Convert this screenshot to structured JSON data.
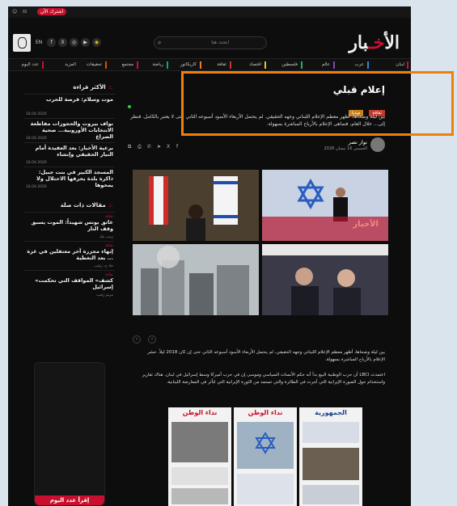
{
  "topbar": {
    "subscribe_label": "اشترك الأن"
  },
  "header": {
    "language": "EN",
    "search_placeholder": "ابحث هنا",
    "logo_main": "الأ",
    "logo_accent": "خـ",
    "logo_end": "بار"
  },
  "nav": {
    "items": [
      {
        "label": "لبنان",
        "color": "#c8102e"
      },
      {
        "label": "عرب",
        "color": "#2e86de"
      },
      {
        "label": "عالم",
        "color": "#8e44ad"
      },
      {
        "label": "فلسطين",
        "color": "#27ae60"
      },
      {
        "label": "اقتصاد",
        "color": "#f1c40f"
      },
      {
        "label": "ثقافة",
        "color": "#c0392b"
      },
      {
        "label": "كاريكاتور",
        "color": "#e67e22"
      },
      {
        "label": "رياضة",
        "color": "#16a085"
      },
      {
        "label": "مجتمع",
        "color": "#c8102e"
      },
      {
        "label": "تحقيقات",
        "color": "#d35400"
      },
      {
        "label": "المزيد",
        "color": "#999999"
      },
      {
        "label": "عدد اليوم",
        "color": "#c8102e"
      }
    ]
  },
  "sidebar": {
    "most_read_title": "الأكثر قراءة",
    "most_read": [
      {
        "cat": "",
        "title": "موت وسلام: فرصة للحرب",
        "date": "18.04.2026",
        "author": ""
      },
      {
        "cat": "",
        "title": "نواف بيروت والحجوزات مقاطعة الانتخابات الأوروبية... ضحية الصراع",
        "date": "18.04.2026",
        "author": ""
      },
      {
        "cat": "",
        "title": "برعية الأخبار: بعد العقيدة أمام التيار الحقيقي وإنشاء",
        "date": "18.04.2026",
        "author": ""
      },
      {
        "cat": "",
        "title": "المسجد الكبير في بنت جبيل: ذاكرة بلدة يحرقها الاحتلال ولا يمحوها",
        "date": "18.04.2026",
        "author": ""
      }
    ],
    "related_title": "مقالات ذات صلة",
    "related": [
      {
        "cat": "ثقافة",
        "title": "عاتق يونس شهيداً: الموت يسبق وقف النار",
        "author": "زينب بنك"
      },
      {
        "cat": "ثقافة",
        "title": "إنهاء مجزرة آخر معتقلين في غزة ... بعد التغطية",
        "author": "جاد ج. زغيب"
      },
      {
        "cat": "ثقافة",
        "title": "«كشف» المواقف التي تحكمت إسرائيل",
        "author": "مريم زغيب"
      }
    ],
    "ad_button": "إقرأ عدد اليوم"
  },
  "article": {
    "title": "إعلام قبلي",
    "tags": [
      "ثقافة",
      "ميديا"
    ],
    "lead": "بين ليلة وضحاها، أظهر معظم الإعلام اللبناني وجهه الحقيقي. لم يحتمل الأربعاء الأسود أسبوعه الثاني حتى لا يعتبر بالكامل. فنظر إلى... خلال العام، فتماهى الإعلام بالأرباح المباشرة بسهولة.",
    "author_name": "نوار نصر",
    "author_date": "الخميس 16 نيسان 2026",
    "image_caption": "الأخبار",
    "body1": "بين ليلة وضحاها، أظهر معظم الإعلام اللبناني وجهه الحقيقي، لم يحتمل الأربعاء الأسود أسبوعه الثاني حتى إن كان 2018 ليلاً. حشر الإعلام بالأرباح المباشرة بسهولة.",
    "body2": "اعتمدت LBCI أن حزب الوطنية البيع بدأ أنه حكم الأنسات السياسي وموسى إن في حرب أميركا وسط إسرائيل في لبنان. هناك تقارير واستخدام حول الصورة الإيرانية التي أجرت في الطائرة والتي تستمد من الثورة الإيرانية التي لتأثر في المعارضة اللبنانية.",
    "papers": [
      {
        "title": "الجمهورية",
        "color": "#1b3e8c"
      },
      {
        "title": "نداء الوطن",
        "color": "#c8102e"
      },
      {
        "title": "نداء الوطن",
        "color": "#c8102e"
      }
    ]
  }
}
